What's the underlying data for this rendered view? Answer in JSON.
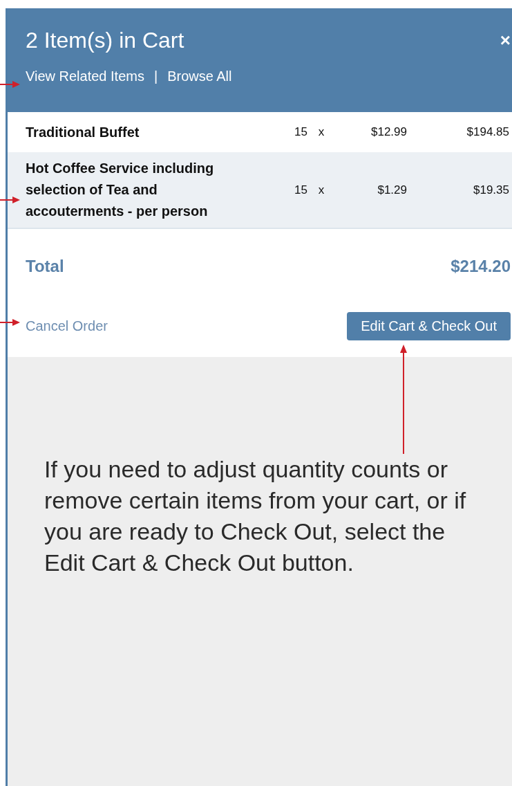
{
  "header": {
    "title": "2 Item(s) in Cart",
    "close": "×",
    "links": [
      {
        "label": "View Related Items"
      },
      {
        "label": "Browse All"
      }
    ],
    "separator": "|"
  },
  "cart": {
    "rows": [
      {
        "name": "Traditional Buffet",
        "qty": "15",
        "times": "x",
        "price": "$12.99",
        "total": "$194.85",
        "shaded": false
      },
      {
        "name": "Hot Coffee Service including selection of Tea and accouterments - per person",
        "qty": "15",
        "times": "x",
        "price": "$1.29",
        "total": "$19.35",
        "shaded": true
      }
    ],
    "total_label": "Total",
    "total_value": "$214.20"
  },
  "actions": {
    "cancel": "Cancel Order",
    "checkout": "Edit Cart & Check Out"
  },
  "annotation": "If you need to adjust quantity counts or remove certain items from your cart, or if you are ready to Check Out, select the Edit Cart & Check Out button."
}
